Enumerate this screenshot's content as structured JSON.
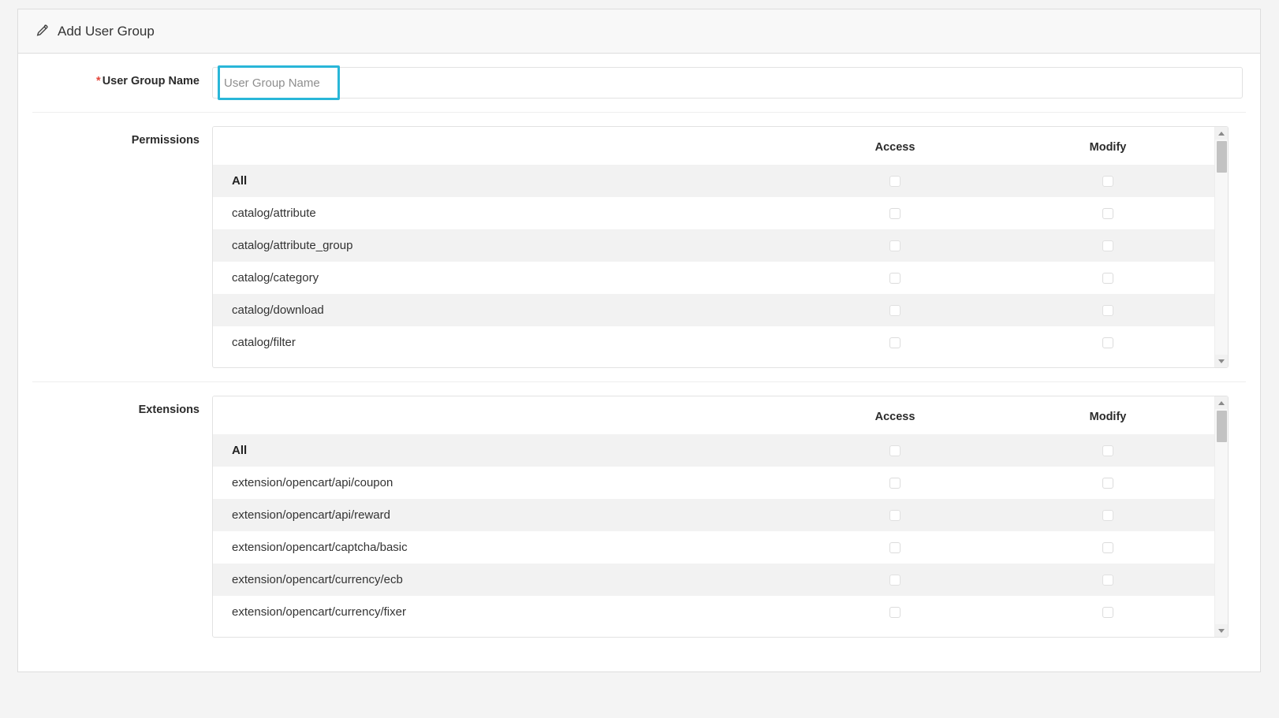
{
  "window": {
    "panel_title": "Add User Group",
    "pencil_icon": "pencil-icon"
  },
  "form": {
    "user_group_name": {
      "label": "User Group Name",
      "required_marker": "*",
      "placeholder": "User Group Name",
      "value": "",
      "focus_highlight_color": "#29b6d8"
    },
    "permissions": {
      "label": "Permissions",
      "columns": {
        "name": "",
        "access": "Access",
        "modify": "Modify"
      },
      "rows": [
        {
          "name": "All",
          "access_checked": false,
          "modify_checked": false,
          "is_all": true
        },
        {
          "name": "catalog/attribute",
          "access_checked": false,
          "modify_checked": false,
          "is_all": false
        },
        {
          "name": "catalog/attribute_group",
          "access_checked": false,
          "modify_checked": false,
          "is_all": false
        },
        {
          "name": "catalog/category",
          "access_checked": false,
          "modify_checked": false,
          "is_all": false
        },
        {
          "name": "catalog/download",
          "access_checked": false,
          "modify_checked": false,
          "is_all": false
        },
        {
          "name": "catalog/filter",
          "access_checked": false,
          "modify_checked": false,
          "is_all": false
        }
      ]
    },
    "extensions": {
      "label": "Extensions",
      "columns": {
        "name": "",
        "access": "Access",
        "modify": "Modify"
      },
      "rows": [
        {
          "name": "All",
          "access_checked": false,
          "modify_checked": false,
          "is_all": true
        },
        {
          "name": "extension/opencart/api/coupon",
          "access_checked": false,
          "modify_checked": false,
          "is_all": false
        },
        {
          "name": "extension/opencart/api/reward",
          "access_checked": false,
          "modify_checked": false,
          "is_all": false
        },
        {
          "name": "extension/opencart/captcha/basic",
          "access_checked": false,
          "modify_checked": false,
          "is_all": false
        },
        {
          "name": "extension/opencart/currency/ecb",
          "access_checked": false,
          "modify_checked": false,
          "is_all": false
        },
        {
          "name": "extension/opencart/currency/fixer",
          "access_checked": false,
          "modify_checked": false,
          "is_all": false
        }
      ]
    }
  },
  "scrollbars": {
    "up_arrow_icon": "chevron-up-icon",
    "down_arrow_icon": "chevron-down-icon"
  },
  "colors": {
    "accent": "#29b6d8",
    "required": "#e4473c",
    "panel_header_bg": "#f8f8f8",
    "stripe_bg": "#f2f2f2",
    "border": "#dddddd"
  }
}
